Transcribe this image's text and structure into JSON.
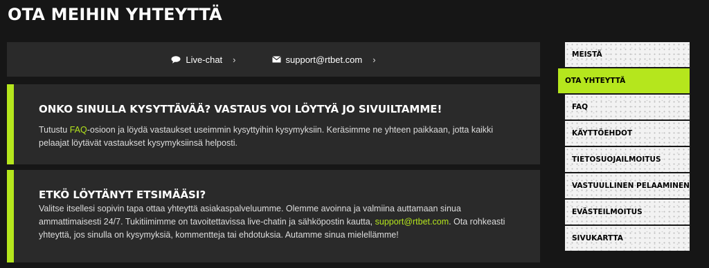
{
  "page_title": "OTA MEIHIN YHTEYTTÄ",
  "contact_bar": {
    "chat_label": "Live-chat",
    "email_label": "support@rtbet.com",
    "chevron": "›",
    "chat_icon": "chat-bubble-icon",
    "email_icon": "envelope-icon"
  },
  "faq_panel": {
    "heading": "ONKO SINULLA KYSYTTÄVÄÄ? VASTAUS VOI LÖYTYÄ JO SIVUILTAMME!",
    "text_before": "Tutustu ",
    "link": "FAQ",
    "text_after": "-osioon ja löydä vastaukset useimmin kysyttyihin kysymyksiin. Keräsimme ne yhteen paikkaan, jotta kaikki pelaajat löytävät vastaukset kysymyksiinsä helposti."
  },
  "help_panel": {
    "heading": "ETKÖ LÖYTÄNYT ETSIMÄÄSI?",
    "text_before": "Valitse itsellesi sopivin tapa ottaa yhteyttä asiakaspalveluumme. Olemme avoinna ja valmiina auttamaan sinua ammattimaisesti 24/7. Tukitiimimme on tavoitettavissa live-chatin ja sähköpostin kautta, ",
    "link": "support@rtbet.com",
    "text_after": ". Ota rohkeasti yhteyttä, jos sinulla on kysymyksiä, kommentteja tai ehdotuksia. Autamme sinua mielellämme!"
  },
  "sidebar": {
    "items": [
      {
        "label": "MEISTÄ",
        "active": false
      },
      {
        "label": "OTA YHTEYTTÄ",
        "active": true
      },
      {
        "label": "FAQ",
        "active": false
      },
      {
        "label": "KÄYTTÖEHDOT",
        "active": false
      },
      {
        "label": "TIETOSUOJAILMOITUS",
        "active": false
      },
      {
        "label": "VASTUULLINEN PELAAMINEN",
        "active": false
      },
      {
        "label": "EVÄSTEILMOITUS",
        "active": false
      },
      {
        "label": "SIVUKARTTA",
        "active": false
      }
    ]
  },
  "colors": {
    "accent": "#b5e61d",
    "background": "#161616",
    "panel": "#2a2a2a"
  }
}
